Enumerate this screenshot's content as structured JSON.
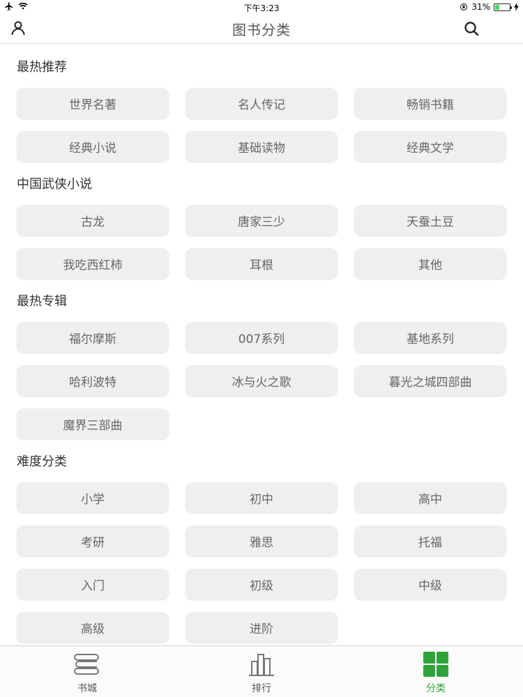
{
  "status_bar": {
    "time": "下午3:23",
    "battery_percent": "31%",
    "battery_level": 0.31
  },
  "nav": {
    "title": "图书分类"
  },
  "sections": [
    {
      "title": "最热推荐",
      "tags": [
        "世界名著",
        "名人传记",
        "畅销书籍",
        "经典小说",
        "基础读物",
        "经典文学"
      ]
    },
    {
      "title": "中国武侠小说",
      "tags": [
        "古龙",
        "唐家三少",
        "天蚕土豆",
        "我吃西红柿",
        "耳根",
        "其他"
      ]
    },
    {
      "title": "最热专辑",
      "tags": [
        "福尔摩斯",
        "007系列",
        "基地系列",
        "哈利波特",
        "冰与火之歌",
        "暮光之城四部曲",
        "魔界三部曲"
      ]
    },
    {
      "title": "难度分类",
      "tags": [
        "小学",
        "初中",
        "高中",
        "考研",
        "雅思",
        "托福",
        "入门",
        "初级",
        "中级",
        "高级",
        "进阶"
      ]
    }
  ],
  "tab_bar": {
    "tabs": [
      {
        "label": "书城",
        "icon": "bookstore-icon"
      },
      {
        "label": "排行",
        "icon": "ranking-icon"
      },
      {
        "label": "分类",
        "icon": "category-icon"
      }
    ],
    "active_color": "#2fa33a"
  }
}
